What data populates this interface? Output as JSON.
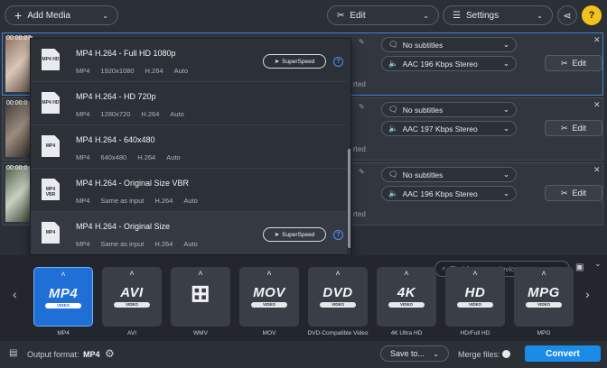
{
  "toolbar": {
    "add_media": "Add Media",
    "edit": "Edit",
    "settings": "Settings",
    "help": "?"
  },
  "files": [
    {
      "time": "00:00:07",
      "subtitles": "No subtitles",
      "audio": "AAC 196 Kbps Stereo",
      "edit_label": "Edit",
      "status": "rted"
    },
    {
      "time": "00:00:0",
      "subtitles": "No subtitles",
      "audio": "AAC 197 Kbps Stereo",
      "edit_label": "Edit",
      "status": "rted"
    },
    {
      "time": "00:00:0",
      "subtitles": "No subtitles",
      "audio": "AAC 196 Kbps Stereo",
      "edit_label": "Edit",
      "status": "rted"
    }
  ],
  "presets": [
    {
      "icon_label": "MP4 HD",
      "title": "MP4 H.264 - Full HD 1080p",
      "specs": [
        "MP4",
        "1920x1080",
        "H.264",
        "Auto"
      ],
      "superspeed": "SuperSpeed"
    },
    {
      "icon_label": "MP4 HD",
      "title": "MP4 H.264 - HD 720p",
      "specs": [
        "MP4",
        "1280x720",
        "H.264",
        "Auto"
      ]
    },
    {
      "icon_label": "MP4",
      "title": "MP4 H.264 - 640x480",
      "specs": [
        "MP4",
        "640x480",
        "H.264",
        "Auto"
      ]
    },
    {
      "icon_label": "MP4 VBR",
      "title": "MP4 H.264 - Original Size VBR",
      "specs": [
        "MP4",
        "Same as input",
        "H.264",
        "Auto"
      ]
    },
    {
      "icon_label": "MP4",
      "title": "MP4 H.264 - Original Size",
      "specs": [
        "MP4",
        "Same as input",
        "H.264",
        "Auto"
      ],
      "superspeed": "SuperSpeed"
    }
  ],
  "search": {
    "placeholder": "Find format or device..."
  },
  "formats": [
    {
      "logo": "MP4",
      "sub": "VIDEO",
      "label": "MP4"
    },
    {
      "logo": "AVI",
      "sub": "VIDEO",
      "label": "AVI"
    },
    {
      "logo": "⊞",
      "sub": "",
      "label": "WMV"
    },
    {
      "logo": "MOV",
      "sub": "VIDEO",
      "label": "MOV"
    },
    {
      "logo": "DVD",
      "sub": "VIDEO",
      "label": "DVD-Compatible Video"
    },
    {
      "logo": "4K",
      "sub": "VIDEO",
      "label": "4K Ultra HD"
    },
    {
      "logo": "HD",
      "sub": "VIDEO",
      "label": "HD/Full HD"
    },
    {
      "logo": "MPG",
      "sub": "VIDEO",
      "label": "MPG"
    }
  ],
  "bottom": {
    "output_label": "Output format:",
    "output_value": "MP4",
    "save_to": "Save to...",
    "merge_files": "Merge files:",
    "convert": "Convert"
  },
  "colors": {
    "accent": "#1a8ce8",
    "help_yellow": "#f1c21b",
    "active_tile": "#1f6fd6"
  }
}
